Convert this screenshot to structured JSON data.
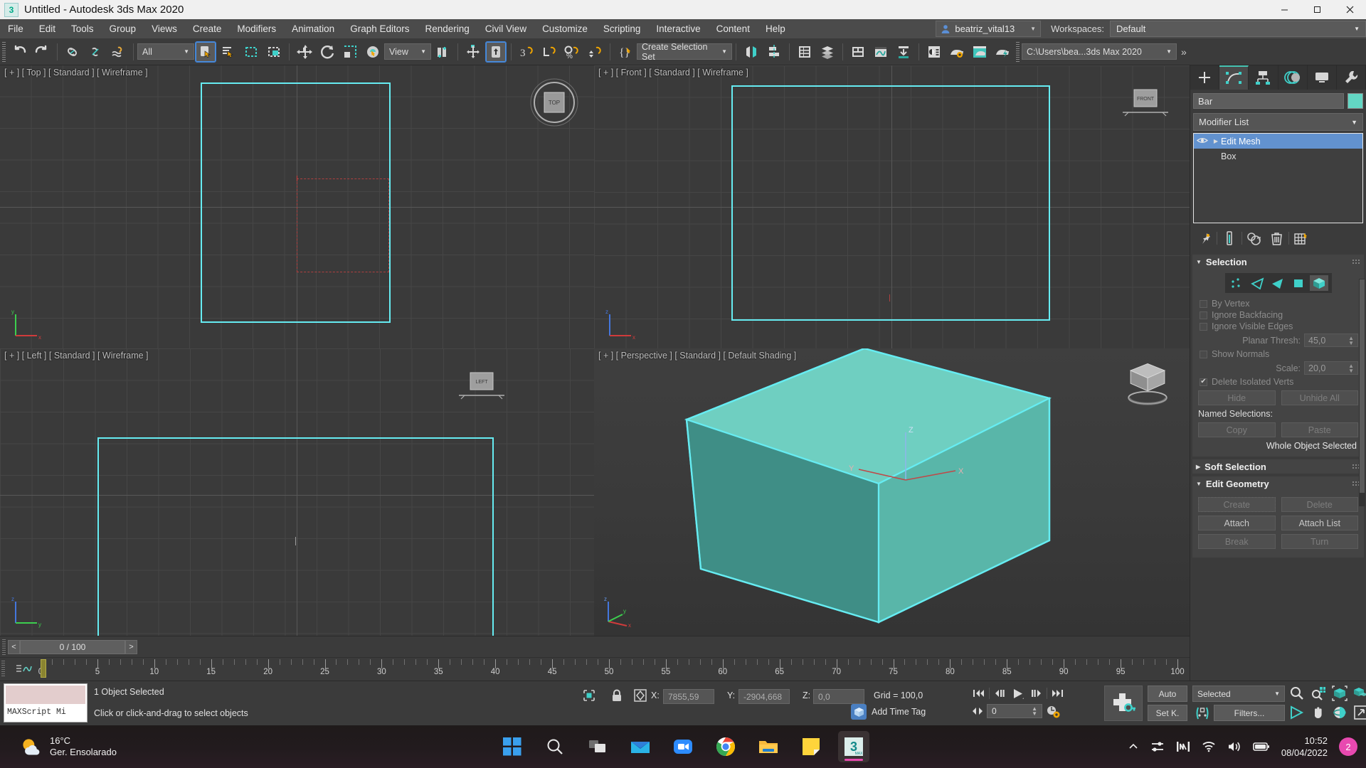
{
  "window": {
    "title": "Untitled - Autodesk 3ds Max 2020",
    "app_icon": "3dsmax-icon",
    "minimize": "–",
    "maximize": "❐",
    "close": "✕"
  },
  "menu": {
    "items": [
      "File",
      "Edit",
      "Tools",
      "Group",
      "Views",
      "Create",
      "Modifiers",
      "Animation",
      "Graph Editors",
      "Rendering",
      "Civil View",
      "Customize",
      "Scripting",
      "Interactive",
      "Content",
      "Help"
    ],
    "user": "beatriz_vital13",
    "workspaces_label": "Workspaces:",
    "workspace_value": "Default"
  },
  "toolbar": {
    "undo": "Undo",
    "redo": "Redo",
    "select_filter": "All",
    "reference_coord": "View",
    "selection_set": "Create Selection Set",
    "project_path": "C:\\Users\\bea...3ds Max 2020",
    "overflow": "»"
  },
  "viewports": [
    {
      "name": "top",
      "label": "[ + ] [ Top ] [ Standard ] [ Wireframe ]"
    },
    {
      "name": "front",
      "label": "[ + ] [ Front ] [ Standard ] [ Wireframe ]"
    },
    {
      "name": "left",
      "label": "[ + ] [ Left ] [ Standard ] [ Wireframe ]"
    },
    {
      "name": "perspective",
      "label": "[ + ] [ Perspective ] [ Standard ] [ Default Shading ]"
    }
  ],
  "viewcubes": {
    "top": "TOP",
    "front": "FRONT",
    "left": "LEFT"
  },
  "timeslider": {
    "prev": "<",
    "next": ">",
    "frame": "0 / 100"
  },
  "trackbar": {
    "ticks": [
      "0",
      "5",
      "10",
      "15",
      "20",
      "25",
      "30",
      "35",
      "40",
      "45",
      "50",
      "55",
      "60",
      "65",
      "70",
      "75",
      "80",
      "85",
      "90",
      "95",
      "100"
    ]
  },
  "status": {
    "maxscript_mini_label": "MAXScript Mi",
    "line1": "1 Object Selected",
    "line2": "Click or click-and-drag to select objects",
    "x_label": "X:",
    "x_value": "7855,59",
    "y_label": "Y:",
    "y_value": "-2904,668",
    "z_label": "Z:",
    "z_value": "0,0",
    "grid": "Grid = 100,0",
    "add_time_tag": "Add Time Tag",
    "auto_key": "Auto",
    "set_key": "Set K.",
    "key_filter_value": "Selected",
    "filters": "Filters...",
    "current_frame": "0"
  },
  "command_panel": {
    "tabs": [
      {
        "name": "create",
        "icon": "plus-icon",
        "selected": false
      },
      {
        "name": "modify",
        "icon": "modify-icon",
        "selected": true
      },
      {
        "name": "hierarchy",
        "icon": "hierarchy-icon",
        "selected": false
      },
      {
        "name": "motion",
        "icon": "motion-icon",
        "selected": false
      },
      {
        "name": "display",
        "icon": "display-icon",
        "selected": false
      },
      {
        "name": "utilities",
        "icon": "wrench-icon",
        "selected": false
      }
    ],
    "object_name": "Bar",
    "object_color": "#63d7c4",
    "modifier_list": "Modifier List",
    "stack": [
      {
        "label": "Edit Mesh",
        "selected": true
      },
      {
        "label": "Box",
        "selected": false
      }
    ],
    "stack_tools": [
      "pin-stack-icon",
      "show-end-result-icon",
      "make-unique-icon",
      "remove-modifier-icon",
      "configure-sets-icon"
    ]
  },
  "selection_rollout": {
    "title": "Selection",
    "sub_object_levels": [
      "vertex",
      "edge",
      "face",
      "polygon",
      "element"
    ],
    "selected_level": "element",
    "by_vertex": {
      "label": "By Vertex",
      "checked": false
    },
    "ignore_backfacing": {
      "label": "Ignore Backfacing",
      "checked": false
    },
    "ignore_visible_edges": {
      "label": "Ignore Visible Edges",
      "checked": false
    },
    "planar_thresh": {
      "label": "Planar Thresh:",
      "value": "45,0"
    },
    "show_normals": {
      "label": "Show Normals",
      "checked": false
    },
    "scale": {
      "label": "Scale:",
      "value": "20,0"
    },
    "delete_isolated_verts": {
      "label": "Delete Isolated Verts",
      "checked": true
    },
    "hide": "Hide",
    "unhide_all": "Unhide All",
    "named_selections": "Named Selections:",
    "copy": "Copy",
    "paste": "Paste",
    "status": "Whole Object Selected"
  },
  "soft_selection_rollout": {
    "title": "Soft Selection"
  },
  "edit_geometry_rollout": {
    "title": "Edit Geometry",
    "buttons": [
      [
        "Create",
        "Delete"
      ],
      [
        "Attach",
        "Attach List"
      ],
      [
        "Break",
        "Turn"
      ]
    ]
  },
  "taskbar": {
    "weather_temp": "16°C",
    "weather_desc": "Ger. Ensolarado",
    "apps": [
      {
        "name": "start",
        "icon": "windows-start-icon"
      },
      {
        "name": "search",
        "icon": "search-icon"
      },
      {
        "name": "task-view",
        "icon": "task-view-icon"
      },
      {
        "name": "mail",
        "icon": "mail-icon"
      },
      {
        "name": "zoom",
        "icon": "video-camera-icon"
      },
      {
        "name": "chrome",
        "icon": "chrome-icon"
      },
      {
        "name": "file-explorer",
        "icon": "folder-icon"
      },
      {
        "name": "sticky-notes",
        "icon": "sticky-note-icon"
      },
      {
        "name": "3dsmax",
        "icon": "3dsmax-icon"
      }
    ],
    "tray": [
      "chevron-up-icon",
      "settings-sliders-icon",
      "intel-graphics-icon",
      "wifi-icon",
      "volume-icon",
      "battery-icon"
    ],
    "time": "10:52",
    "date": "08/04/2022",
    "notification_count": "2"
  },
  "colors": {
    "accent_teal": "#46c3b2",
    "selection_cyan": "#66ecf2",
    "object_fill": "#5fbfb0",
    "highlight_blue": "#6292cf",
    "active_viewport_border": "#e8a33d"
  }
}
